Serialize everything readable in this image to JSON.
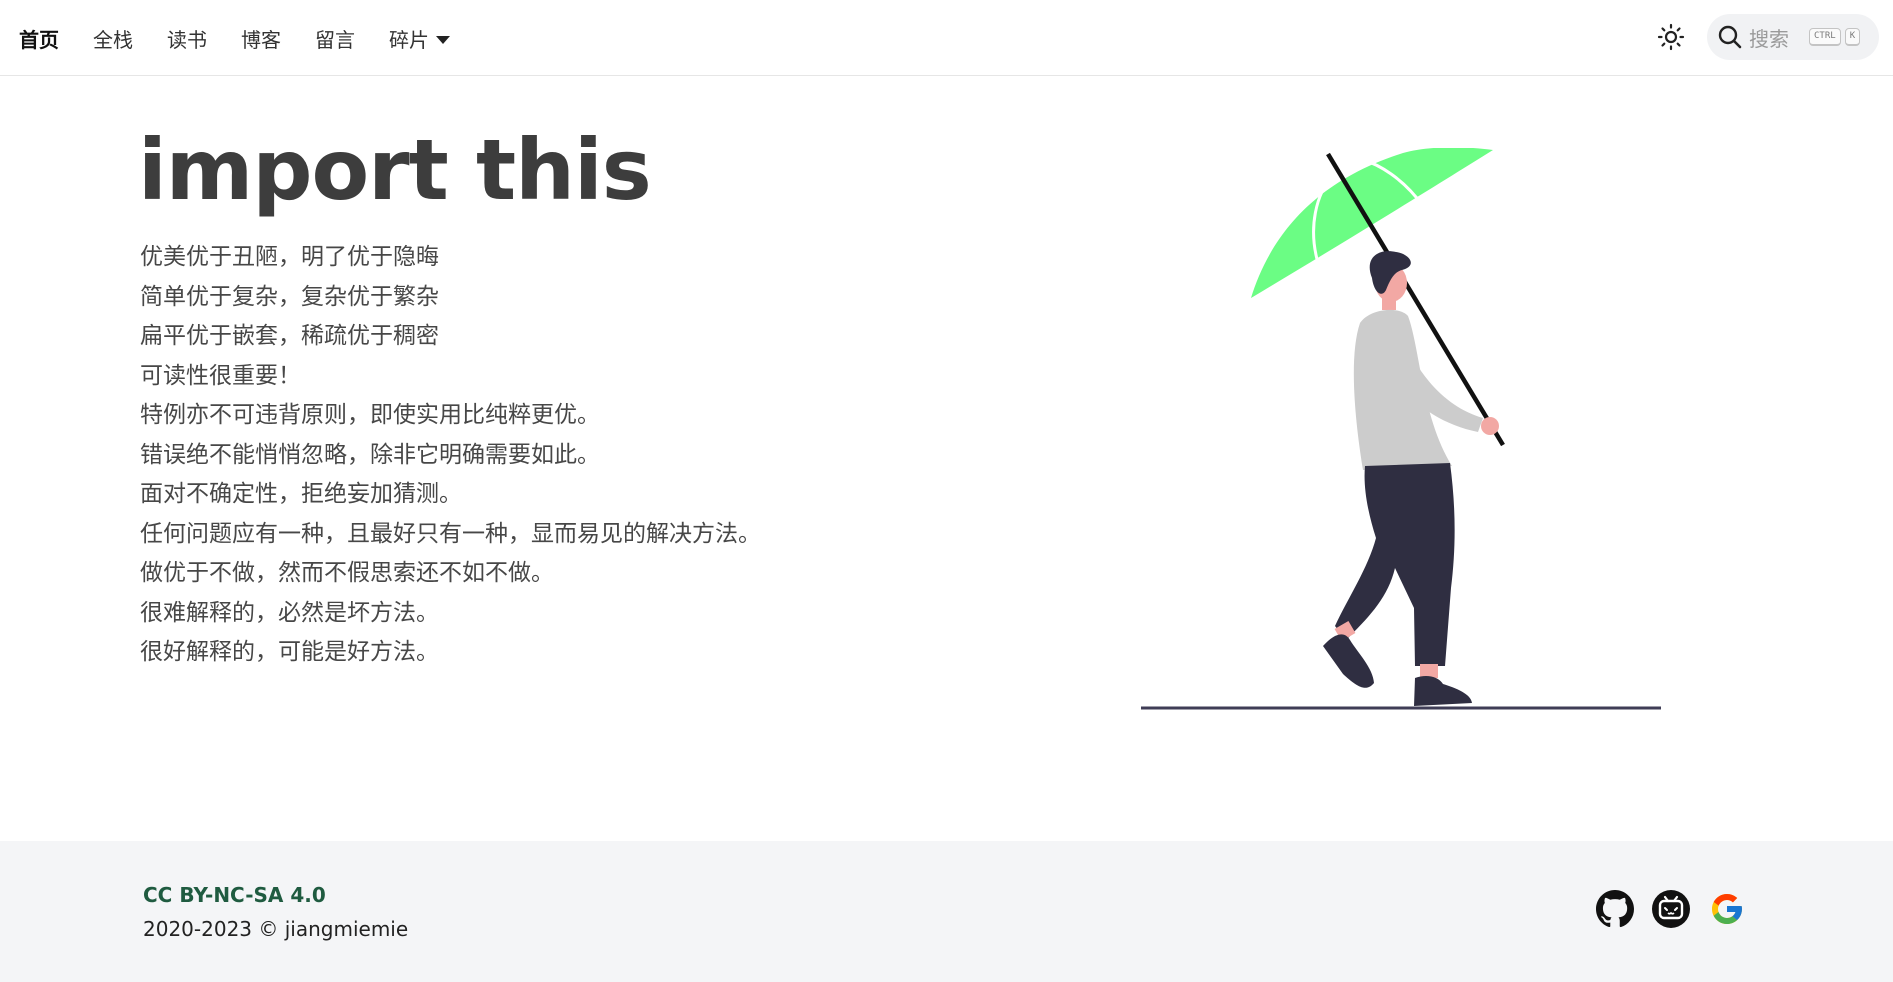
{
  "nav": {
    "items": [
      {
        "label": "首页",
        "active": true
      },
      {
        "label": "全栈",
        "active": false
      },
      {
        "label": "读书",
        "active": false
      },
      {
        "label": "博客",
        "active": false
      },
      {
        "label": "留言",
        "active": false
      },
      {
        "label": "碎片",
        "active": false,
        "dropdown": true
      }
    ],
    "theme_icon": "sun-icon",
    "search": {
      "placeholder": "搜索",
      "shortcut_keys": [
        "CTRL",
        "K"
      ]
    }
  },
  "hero": {
    "title": "import this",
    "lines": [
      "优美优于丑陋，明了优于隐晦",
      "简单优于复杂，复杂优于繁杂",
      "扁平优于嵌套，稀疏优于稠密",
      "可读性很重要！",
      "特例亦不可违背原则，即使实用比纯粹更优。",
      "错误绝不能悄悄忽略，除非它明确需要如此。",
      "面对不确定性，拒绝妄加猜测。",
      "任何问题应有一种，且最好只有一种，显而易见的解决方法。",
      "做优于不做，然而不假思索还不如不做。",
      "很难解释的，必然是坏方法。",
      "很好解释的，可能是好方法。"
    ],
    "illustration": "person-with-umbrella-illustration",
    "umbrella_color": "#6bfd84"
  },
  "footer": {
    "license": "CC BY-NC-SA 4.0",
    "copyright": "2020-2023 © jiangmiemie",
    "social": [
      "github-icon",
      "bilibili-icon",
      "google-icon"
    ],
    "license_color": "#1f5b40",
    "background": "#f4f5f7"
  }
}
